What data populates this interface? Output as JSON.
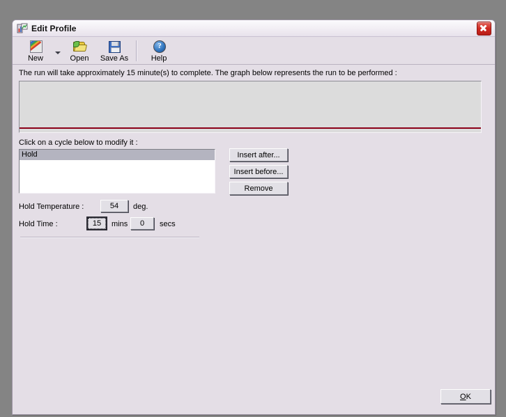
{
  "window": {
    "title": "Edit Profile",
    "icon": "profile-chart-icon",
    "close_label": "Close",
    "background": "#e4dee6",
    "desktop_background": "#848484"
  },
  "toolbar": {
    "items": [
      {
        "label": "New",
        "icon": "new-profile-icon"
      },
      {
        "label": "Open",
        "icon": "open-folder-icon"
      },
      {
        "label": "Save As",
        "icon": "floppy-disk-icon"
      },
      {
        "label": "Help",
        "icon": "help-question-icon"
      }
    ],
    "dropdown_icon": "chevron-down-icon",
    "help_glyph": "?"
  },
  "main": {
    "run_description": "The run will take approximately 15 minute(s) to complete. The graph below represents the run to be performed :",
    "graph": {
      "baseline_color": "#8b0018",
      "panel_color": "#dcdcdc"
    },
    "cycle_prompt": "Click on a cycle below to modify it :",
    "cycle_list": [
      {
        "label": "Hold",
        "selected": true
      }
    ],
    "cycle_buttons": {
      "insert_after": "Insert after...",
      "insert_before": "Insert before...",
      "remove": "Remove"
    },
    "fields": {
      "hold_temperature_label": "Hold Temperature :",
      "hold_temperature_value": "54",
      "hold_temperature_unit": "deg.",
      "hold_time_label": "Hold Time :",
      "hold_time_mins_value": "15",
      "hold_time_mins_unit": "mins",
      "hold_time_secs_value": "0",
      "hold_time_secs_unit": "secs"
    }
  },
  "footer": {
    "ok_mnemonic": "O",
    "ok_rest": "K"
  }
}
